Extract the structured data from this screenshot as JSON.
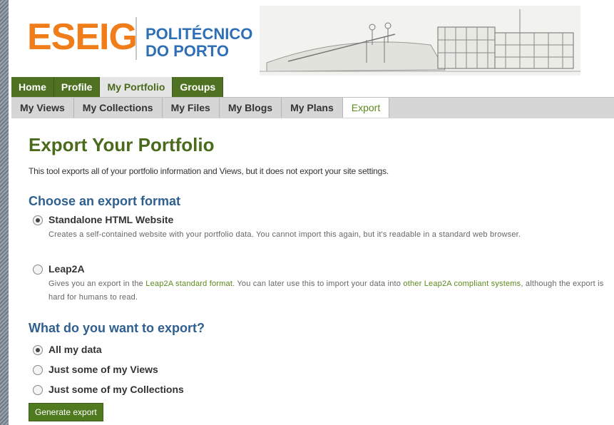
{
  "header": {
    "logo_main": "ESEIG",
    "logo_line1": "POLITÉCNICO",
    "logo_line2": "DO PORTO",
    "brand_orange": "#f07c1a",
    "brand_blue": "#2f6fb5"
  },
  "nav_primary": {
    "tabs": [
      {
        "label": "Home"
      },
      {
        "label": "Profile"
      },
      {
        "label": "My Portfolio"
      },
      {
        "label": "Groups"
      }
    ],
    "active": "My Portfolio"
  },
  "nav_secondary": {
    "tabs": [
      {
        "label": "My Views"
      },
      {
        "label": "My Collections"
      },
      {
        "label": "My Files"
      },
      {
        "label": "My Blogs"
      },
      {
        "label": "My Plans"
      },
      {
        "label": "Export"
      }
    ],
    "active": "Export"
  },
  "main": {
    "title": "Export Your Portfolio",
    "intro": "This tool exports all of your portfolio information and Views, but it does not export your site settings.",
    "format_heading": "Choose an export format",
    "formats": [
      {
        "label": "Standalone HTML Website",
        "checked": true,
        "description": "Creates a self-contained website with your portfolio data. You cannot import this again, but it's readable in a standard web browser."
      },
      {
        "label": "Leap2A",
        "checked": false,
        "desc_part1": "Gives you an export in the ",
        "desc_link1": "Leap2A standard format",
        "desc_part2": ". You can later use this to import your data into ",
        "desc_link2": "other Leap2A compliant systems",
        "desc_part3": ", although the export is hard for humans to read."
      }
    ],
    "what_heading": "What do you want to export?",
    "what_options": [
      {
        "label": "All my data",
        "checked": true
      },
      {
        "label": "Just some of my Views",
        "checked": false
      },
      {
        "label": "Just some of my Collections",
        "checked": false
      }
    ],
    "submit_label": "Generate export"
  }
}
